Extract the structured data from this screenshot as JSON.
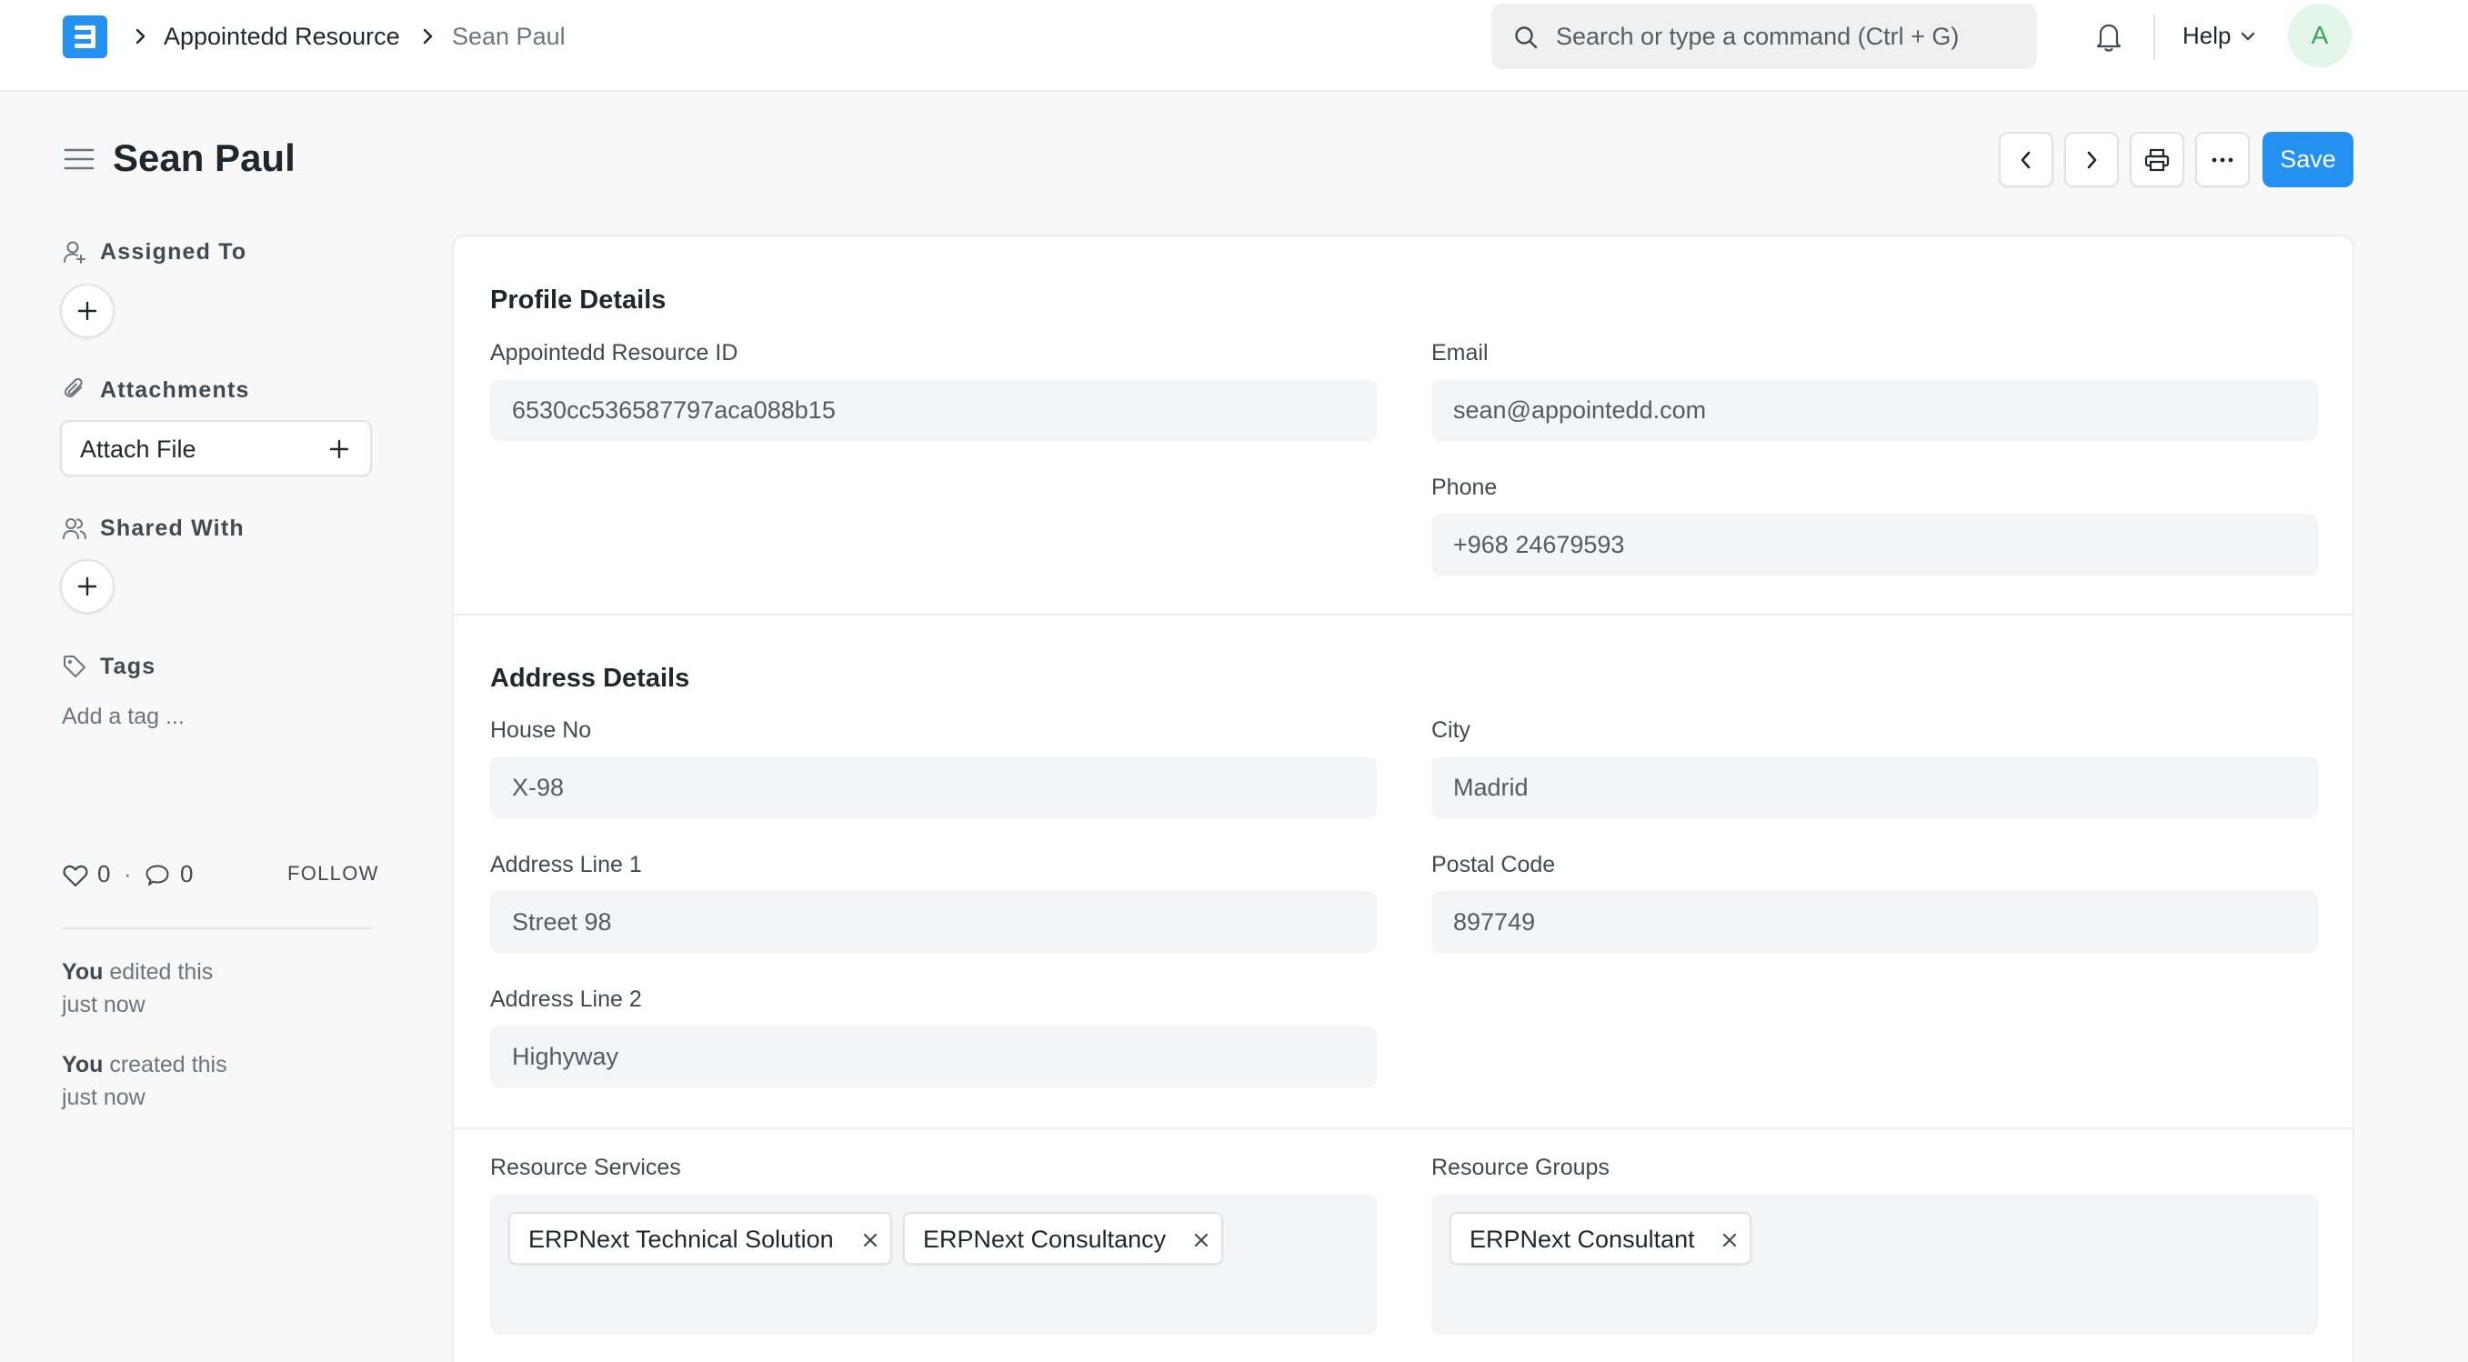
{
  "navbar": {
    "breadcrumbs": [
      "Appointedd Resource",
      "Sean Paul"
    ],
    "search_placeholder": "Search or type a command (Ctrl + G)",
    "help_label": "Help",
    "avatar_initial": "A"
  },
  "page": {
    "title": "Sean Paul",
    "save_label": "Save"
  },
  "sidebar": {
    "assigned_to_label": "Assigned To",
    "attachments_label": "Attachments",
    "attach_file_label": "Attach File",
    "shared_with_label": "Shared With",
    "tags_label": "Tags",
    "add_tag_placeholder": "Add a tag ...",
    "like_count": "0",
    "separator": "·",
    "comment_count": "0",
    "follow_label": "FOLLOW",
    "activity": [
      {
        "actor": "You",
        "action": "edited this",
        "time": "just now"
      },
      {
        "actor": "You",
        "action": "created this",
        "time": "just now"
      }
    ]
  },
  "form": {
    "profile_section": {
      "title": "Profile Details",
      "resource_id_label": "Appointedd Resource ID",
      "resource_id_value": "6530cc536587797aca088b15",
      "email_label": "Email",
      "email_value": "sean@appointedd.com",
      "phone_label": "Phone",
      "phone_value": "+968 24679593"
    },
    "address_section": {
      "title": "Address Details",
      "house_no_label": "House No",
      "house_no_value": "X-98",
      "city_label": "City",
      "city_value": "Madrid",
      "address_line1_label": "Address Line 1",
      "address_line1_value": "Street 98",
      "postal_code_label": "Postal Code",
      "postal_code_value": "897749",
      "address_line2_label": "Address Line 2",
      "address_line2_value": "Highyway"
    },
    "resources_section": {
      "services_label": "Resource Services",
      "services": [
        "ERPNext Technical Solution",
        "ERPNext Consultancy"
      ],
      "groups_label": "Resource Groups",
      "groups": [
        "ERPNext Consultant"
      ]
    }
  },
  "colors": {
    "primary": "#2490ef",
    "avatar_bg": "#e4f5e9",
    "avatar_fg": "#36a64f",
    "input_bg": "#f4f5f6"
  },
  "icons": [
    "app-logo-icon",
    "chevron-right-icon",
    "search-icon",
    "bell-icon",
    "chevron-down-icon",
    "hamburger-icon",
    "chevron-left-icon",
    "printer-icon",
    "more-icon",
    "user-plus-icon",
    "plus-icon",
    "paperclip-icon",
    "users-icon",
    "tag-icon",
    "heart-icon",
    "comment-icon",
    "close-icon"
  ]
}
